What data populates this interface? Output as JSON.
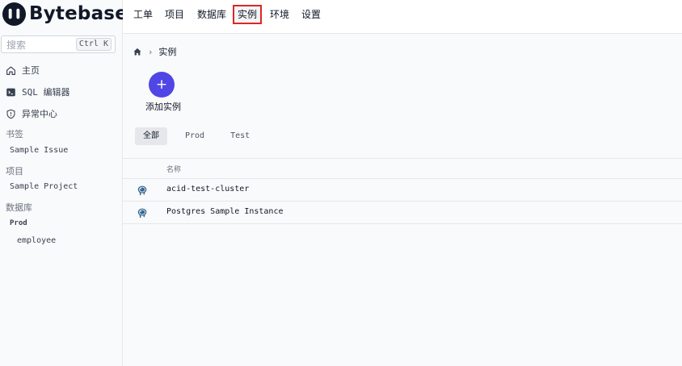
{
  "app": {
    "name": "Bytebase"
  },
  "sidebar": {
    "search": {
      "placeholder": "搜索",
      "shortcut": "Ctrl K"
    },
    "nav": [
      {
        "label": "主页",
        "icon": "home-icon"
      },
      {
        "label": "SQL 编辑器",
        "icon": "terminal-icon"
      },
      {
        "label": "异常中心",
        "icon": "shield-icon"
      }
    ],
    "sections": {
      "bookmarks": {
        "title": "书签",
        "items": [
          "Sample Issue"
        ]
      },
      "projects": {
        "title": "项目",
        "items": [
          "Sample Project"
        ]
      },
      "databases": {
        "title": "数据库",
        "env": "Prod",
        "items": [
          "employee"
        ]
      }
    }
  },
  "topnav": {
    "tabs": [
      "工单",
      "项目",
      "数据库",
      "实例",
      "环境",
      "设置"
    ],
    "active": "实例"
  },
  "breadcrumb": {
    "current": "实例"
  },
  "actions": {
    "add_label": "添加实例",
    "add_symbol": "+"
  },
  "filters": {
    "tabs": [
      "全部",
      "Prod",
      "Test"
    ],
    "active": "全部"
  },
  "table": {
    "header": "名称",
    "rows": [
      {
        "name": "acid-test-cluster",
        "engine_icon": "postgres-icon"
      },
      {
        "name": "Postgres Sample Instance",
        "engine_icon": "postgres-icon"
      }
    ]
  },
  "colors": {
    "accent": "#4f46e5",
    "highlight_border": "#dc2626"
  }
}
